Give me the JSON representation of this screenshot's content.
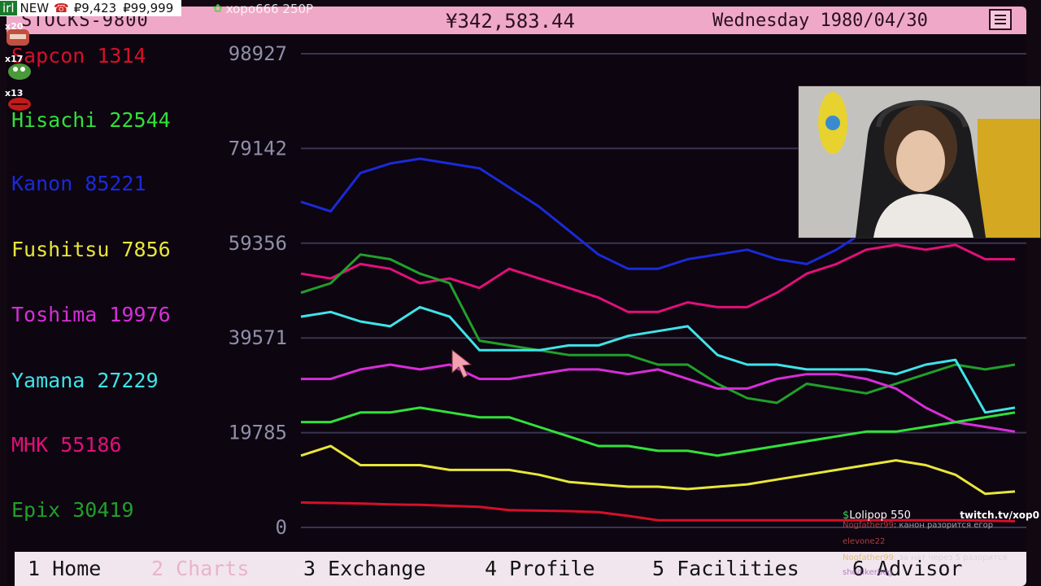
{
  "topbar": {
    "app_title": "STOCKS-9800",
    "balance": "¥342,583.44",
    "date": "Wednesday 1980/04/30",
    "menu_icon": "menu-icon"
  },
  "stocks": [
    {
      "label": "Sapcon 1314",
      "color": "#d4102a"
    },
    {
      "label": "Hisachi 22544",
      "color": "#31e13a"
    },
    {
      "label": "Kanon 85221",
      "color": "#1a2ad8"
    },
    {
      "label": "Fushitsu 7856",
      "color": "#e8e63a"
    },
    {
      "label": "Toshima 19976",
      "color": "#d62ed8"
    },
    {
      "label": "Yamana 27229",
      "color": "#3ee4e8"
    },
    {
      "label": "MHK 55186",
      "color": "#e0107a"
    },
    {
      "label": "Epix 30419",
      "color": "#20a02a"
    }
  ],
  "chart_data": {
    "type": "line",
    "ylim": [
      0,
      98927
    ],
    "yticks": [
      "98927",
      "79142",
      "59356",
      "39571",
      "19785",
      "0"
    ],
    "grid": true,
    "x": [
      0,
      1,
      2,
      3,
      4,
      5,
      6,
      7,
      8,
      9,
      10,
      11,
      12,
      13,
      14,
      15,
      16,
      17,
      18,
      19,
      20,
      21,
      22,
      23,
      24
    ],
    "series": [
      {
        "name": "Kanon",
        "color": "#1a2ad8",
        "values": [
          68000,
          66000,
          74000,
          76000,
          77000,
          76000,
          75000,
          71000,
          67000,
          62000,
          57000,
          54000,
          54000,
          56000,
          57000,
          58000,
          56000,
          55000,
          58000,
          62000,
          68000,
          78000,
          86000,
          89000,
          86000
        ]
      },
      {
        "name": "MHK",
        "color": "#e0107a",
        "values": [
          53000,
          52000,
          55000,
          54000,
          51000,
          52000,
          50000,
          54000,
          52000,
          50000,
          48000,
          45000,
          45000,
          47000,
          46000,
          46000,
          49000,
          53000,
          55000,
          58000,
          59000,
          58000,
          59000,
          56000,
          56000
        ]
      },
      {
        "name": "Epix",
        "color": "#20a02a",
        "values": [
          49000,
          51000,
          57000,
          56000,
          53000,
          51000,
          39000,
          38000,
          37000,
          36000,
          36000,
          36000,
          34000,
          34000,
          30000,
          27000,
          26000,
          30000,
          29000,
          28000,
          30000,
          32000,
          34000,
          33000,
          34000
        ]
      },
      {
        "name": "Yamana",
        "color": "#3ee4e8",
        "values": [
          44000,
          45000,
          43000,
          42000,
          46000,
          44000,
          37000,
          37000,
          37000,
          38000,
          38000,
          40000,
          41000,
          42000,
          36000,
          34000,
          34000,
          33000,
          33000,
          33000,
          32000,
          34000,
          35000,
          24000,
          25000
        ]
      },
      {
        "name": "Toshima",
        "color": "#d62ed8",
        "values": [
          31000,
          31000,
          33000,
          34000,
          33000,
          34000,
          31000,
          31000,
          32000,
          33000,
          33000,
          32000,
          33000,
          31000,
          29000,
          29000,
          31000,
          32000,
          32000,
          31000,
          29000,
          25000,
          22000,
          21000,
          20000
        ]
      },
      {
        "name": "Hisachi",
        "color": "#31e13a",
        "values": [
          22000,
          22000,
          24000,
          24000,
          25000,
          24000,
          23000,
          23000,
          21000,
          19000,
          17000,
          17000,
          16000,
          16000,
          15000,
          16000,
          17000,
          18000,
          19000,
          20000,
          20000,
          21000,
          22000,
          23000,
          24000
        ]
      },
      {
        "name": "Fushitsu",
        "color": "#e8e63a",
        "values": [
          15000,
          17000,
          13000,
          13000,
          13000,
          12000,
          12000,
          12000,
          11000,
          9500,
          9000,
          8500,
          8500,
          8000,
          8500,
          9000,
          10000,
          11000,
          12000,
          13000,
          14000,
          13000,
          11000,
          7000,
          7500
        ]
      },
      {
        "name": "Sapcon",
        "color": "#d4102a",
        "values": [
          5200,
          5100,
          5000,
          4800,
          4700,
          4500,
          4300,
          3600,
          3500,
          3400,
          3200,
          2400,
          1500,
          1500,
          1500,
          1500,
          1500,
          1500,
          1500,
          1500,
          1500,
          1500,
          1500,
          1400,
          1300
        ]
      }
    ]
  },
  "nav": [
    {
      "label": "1 Home",
      "active": false
    },
    {
      "label": "2 Charts",
      "active": true
    },
    {
      "label": "3 Exchange",
      "active": false
    },
    {
      "label": "4 Profile",
      "active": false
    },
    {
      "label": "5 Facilities",
      "active": false
    },
    {
      "label": "6 Advisor",
      "active": false
    }
  ],
  "stream": {
    "irl": "irl",
    "new": "NEW",
    "phone_icon": "phone-icon",
    "amount_left": "₽9,423",
    "amount_right": "₽99,999",
    "follower": "xopo666 250Р",
    "emote_counts": [
      "x20",
      "x17",
      "x13"
    ],
    "donation_amount": "$",
    "donation": "Lolipop 550",
    "channel": "twitch.tv/xop0",
    "chat_lines": [
      {
        "user": "Nogfather99",
        "text": "канон разорится егор"
      },
      {
        "user": "elevone22",
        "text": ""
      },
      {
        "user": "Nogfather99",
        "text": "за нат через 5 разорится"
      },
      {
        "user": "sheitikerbeg",
        "text": ""
      }
    ]
  }
}
